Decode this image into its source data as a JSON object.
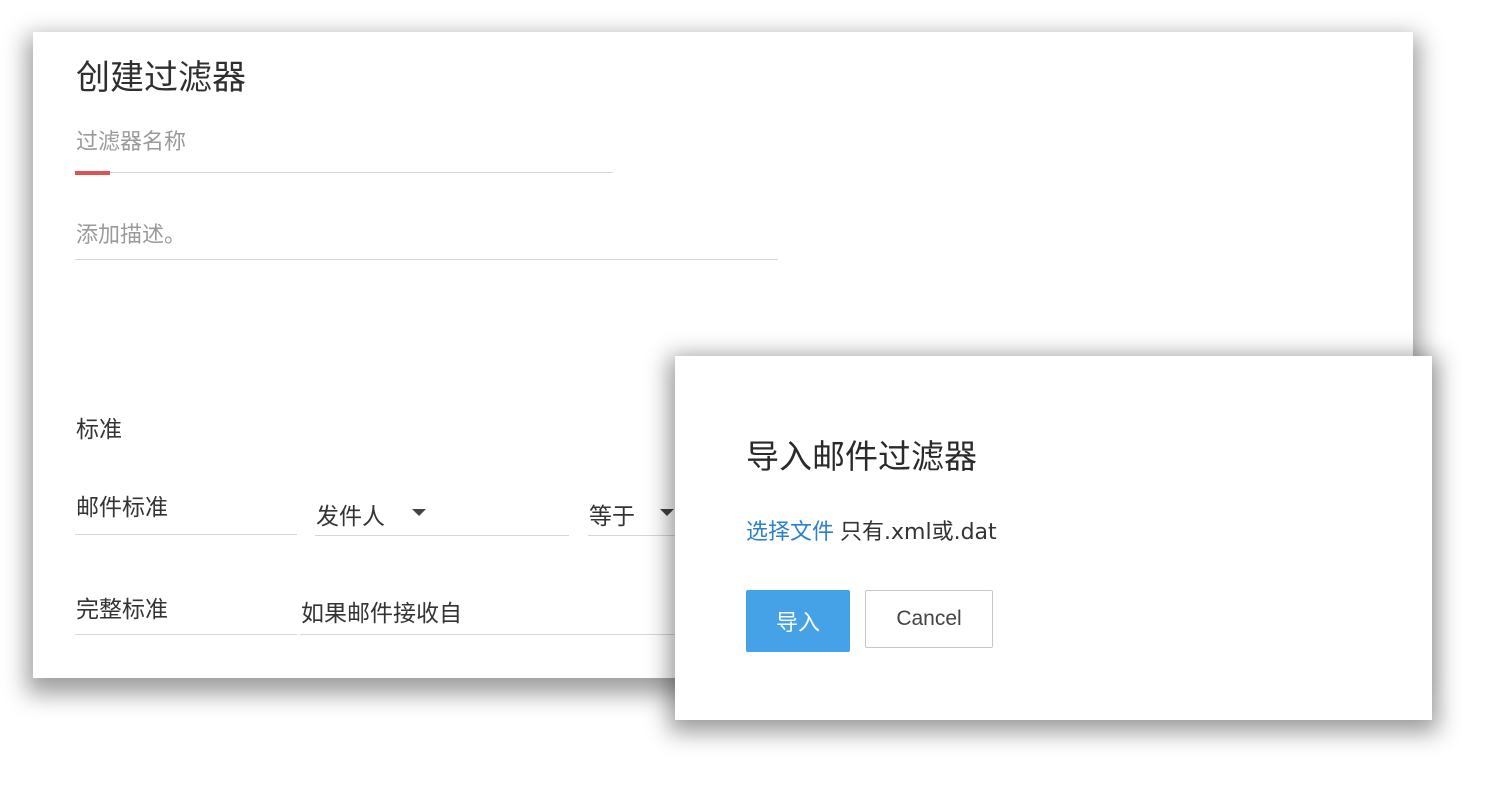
{
  "main": {
    "title": "创建过滤器",
    "name_placeholder": "过滤器名称",
    "description_placeholder": "添加描述。",
    "criteria_section_label": "标准",
    "mail_criteria": {
      "label": "邮件标准",
      "field_value": "发件人",
      "operator_value": "等于"
    },
    "full_criteria": {
      "label": "完整标准",
      "value": "如果邮件接收自"
    },
    "colors": {
      "required_indicator": "#e05252"
    }
  },
  "dialog": {
    "title": "导入邮件过滤器",
    "choose_file_link": "选择文件",
    "file_type_hint": "只有.xml或.dat",
    "import_button": "导入",
    "cancel_button": "Cancel",
    "colors": {
      "primary": "#45a2e6",
      "link": "#2d7fd0"
    }
  }
}
